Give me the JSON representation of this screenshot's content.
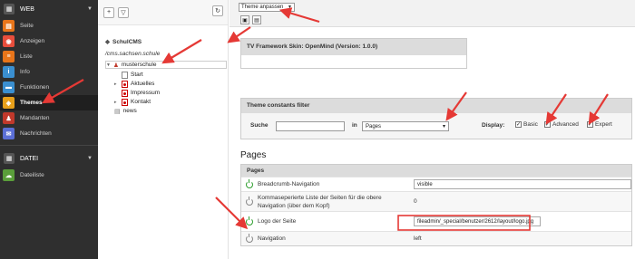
{
  "modmenu": {
    "web_group": "WEB",
    "web_items": [
      {
        "label": "Seite",
        "icon": "page-icon",
        "color": "#e8751a"
      },
      {
        "label": "Anzeigen",
        "icon": "eye-icon",
        "color": "#e84e3c"
      },
      {
        "label": "Liste",
        "icon": "list-icon",
        "color": "#e8751a"
      },
      {
        "label": "Info",
        "icon": "info-icon",
        "color": "#3a8fd0"
      },
      {
        "label": "Funktionen",
        "icon": "toolbox-icon",
        "color": "#3a8fd0"
      },
      {
        "label": "Themes",
        "icon": "themes-icon",
        "color": "#e8a01a"
      },
      {
        "label": "Mandanten",
        "icon": "users-icon",
        "color": "#c0392b"
      },
      {
        "label": "Nachrichten",
        "icon": "mail-icon",
        "color": "#5b6fd6"
      }
    ],
    "file_group": "DATEI",
    "file_items": [
      {
        "label": "Dateiliste",
        "icon": "cloud-icon",
        "color": "#5a9e3a"
      }
    ]
  },
  "tree": {
    "root": "SchulCMS",
    "domain": "/cms.sachsen.schule",
    "nodes": [
      "musterschule",
      "Start",
      "Aktuelles",
      "Impressum",
      "Kontakt",
      "news"
    ]
  },
  "topbar": {
    "theme_select": "Theme anpassen"
  },
  "framework": {
    "title": "TV Framework Skin: OpenMind (Version: 1.0.0)"
  },
  "filter": {
    "title": "Theme constants filter",
    "search_label": "Suche",
    "in_label": "in",
    "page_select": "Pages",
    "display_label": "Display:",
    "basic": "Basic",
    "advanced": "Advanced",
    "expert": "Expert"
  },
  "pages": {
    "section_title": "Pages",
    "table_title": "Pages",
    "rows": [
      {
        "label": "Breadcrumb-Navigation",
        "value": "visible",
        "input": true,
        "active": true
      },
      {
        "label": "Kommaseperierte Liste der Seiten für die obere Navigation (über dem Kopf)",
        "value": "0",
        "input": false,
        "active": false
      },
      {
        "label": "Logo der Seite",
        "value": "fileadmin/_special/benutzer/2612/layout/logo.jpg",
        "input": true,
        "active": true
      },
      {
        "label": "Navigation",
        "value": "left",
        "input": false,
        "active": false
      }
    ]
  },
  "colors": {
    "annotation_red": "#e53935",
    "sidebar_bg": "#2f2f2f"
  }
}
